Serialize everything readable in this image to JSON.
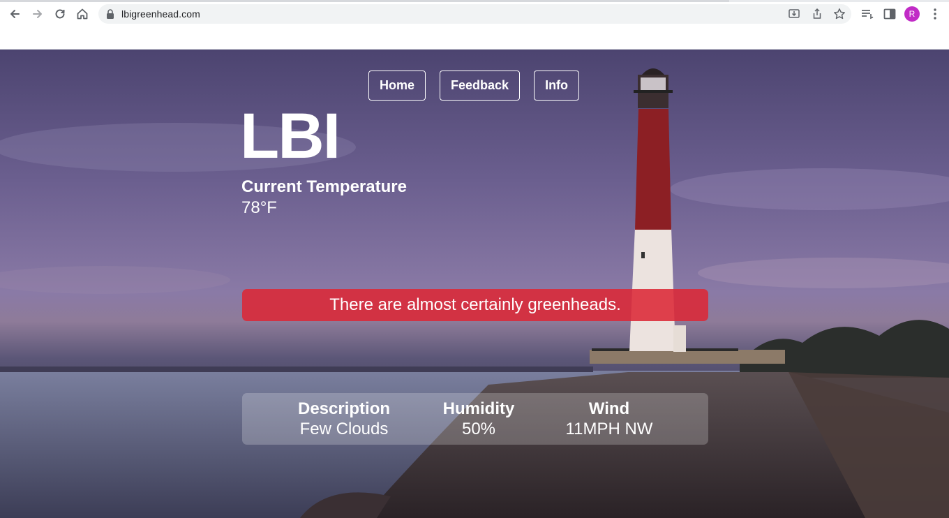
{
  "browser": {
    "url": "lbigreenhead.com",
    "profile_initial": "R",
    "icons": [
      "back-icon",
      "forward-icon",
      "reload-icon",
      "home-icon",
      "lock-icon",
      "install-icon",
      "share-icon",
      "star-icon",
      "reading-list-icon",
      "side-panel-icon",
      "menu-icon"
    ]
  },
  "nav": {
    "home": "Home",
    "feedback": "Feedback",
    "info": "Info"
  },
  "weather": {
    "city": "LBI",
    "temp_label": "Current Temperature",
    "temp_value": "78°F",
    "alert": "There are almost certainly greenheads.",
    "description_label": "Description",
    "description_value": "Few Clouds",
    "humidity_label": "Humidity",
    "humidity_value": "50%",
    "wind_label": "Wind",
    "wind_value": "11MPH NW"
  },
  "colors": {
    "alert": "#dc2837",
    "avatar": "#c12bc6"
  }
}
